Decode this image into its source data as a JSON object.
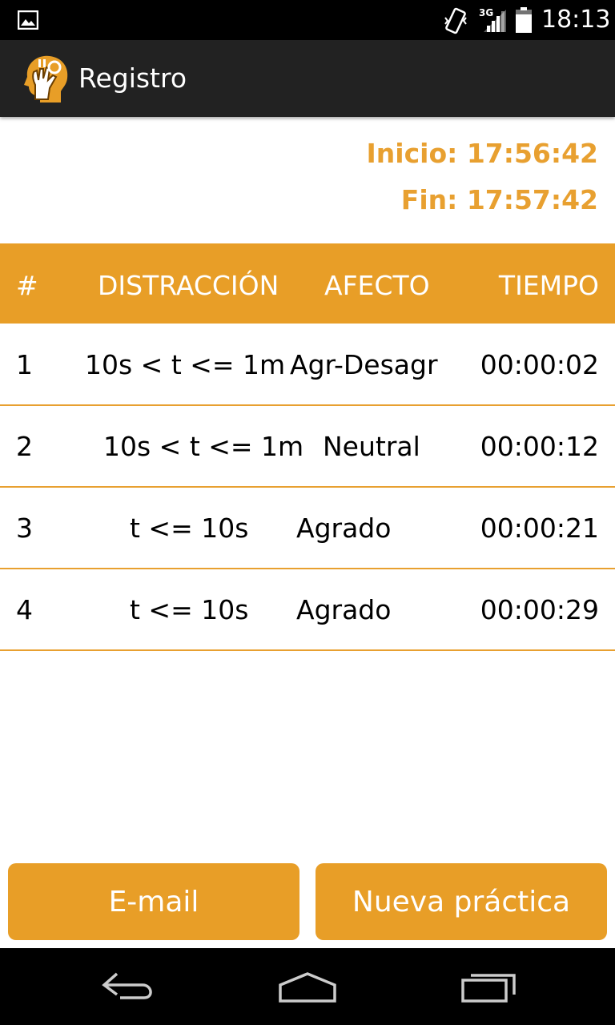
{
  "status_bar": {
    "time": "18:13",
    "network_type": "3G",
    "icons": [
      "image-notification-icon",
      "vibrate-icon",
      "signal-icon",
      "battery-icon"
    ]
  },
  "action_bar": {
    "title": "Registro",
    "logo_icon": "head-hand-logo-icon"
  },
  "session": {
    "start_label": "Inicio: 17:56:42",
    "end_label": "Fin: 17:57:42"
  },
  "table": {
    "headers": [
      "#",
      "DISTRACCIÓN",
      "AFECTO",
      "TIEMPO"
    ],
    "rows": [
      [
        "1",
        "10s < t <= 1m",
        "Agr-Desagr",
        "00:00:02"
      ],
      [
        "2",
        "10s < t <= 1m",
        "Neutral",
        "00:00:12"
      ],
      [
        "3",
        "t <= 10s",
        "Agrado",
        "00:00:21"
      ],
      [
        "4",
        "t <= 10s",
        "Agrado",
        "00:00:29"
      ]
    ]
  },
  "buttons": {
    "email": "E-mail",
    "new_practice": "Nueva práctica"
  },
  "colors": {
    "accent": "#E89E27",
    "action_bar": "#222222",
    "status_bar": "#000000"
  },
  "nav_bar": {
    "icons": [
      "back-icon",
      "home-icon",
      "recent-apps-icon"
    ]
  }
}
